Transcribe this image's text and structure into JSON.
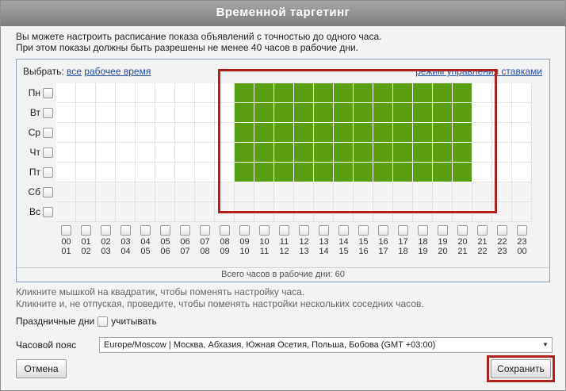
{
  "dialog": {
    "title": "Временной таргетинг",
    "info_line1": "Вы можете настроить расписание показа объявлений с точностью до одного часа.",
    "info_line2": "При этом показы должны быть разрешены не менее 40 часов в рабочие дни."
  },
  "panel": {
    "select_label": "Выбрать:",
    "select_all": "все",
    "select_work_time": "рабочее время",
    "mode_link": "режим управления ставками",
    "days": [
      "Пн",
      "Вт",
      "Ср",
      "Чт",
      "Пт",
      "Сб",
      "Вс"
    ],
    "hours_from": [
      "00",
      "01",
      "02",
      "03",
      "04",
      "05",
      "06",
      "07",
      "08",
      "09",
      "10",
      "11",
      "12",
      "13",
      "14",
      "15",
      "16",
      "17",
      "18",
      "19",
      "20",
      "21",
      "22",
      "23"
    ],
    "hours_to": [
      "01",
      "02",
      "03",
      "04",
      "05",
      "06",
      "07",
      "08",
      "09",
      "10",
      "11",
      "12",
      "13",
      "14",
      "15",
      "16",
      "17",
      "18",
      "19",
      "20",
      "21",
      "22",
      "23",
      "00"
    ],
    "schedule": {
      "weekdays_active_hours": "09–21",
      "weekdays_active_from_index": 9,
      "weekdays_active_to_index": 20,
      "weekend_active": false
    },
    "total_text": "Всего часов в рабочие дни: 60"
  },
  "hint": {
    "line1": "Кликните мышкой на квадратик, чтобы поменять настройку часа.",
    "line2": "Кликните и, не отпуская, проведите, чтобы поменять настройки нескольких соседних часов."
  },
  "holidays": {
    "label": "Праздничные дни",
    "checkbox_label": "учитывать"
  },
  "timezone": {
    "label": "Часовой пояс",
    "value": "Europe/Moscow | Москва, Абхазия, Южная Осетия, Польша, Бобова (GMT +03:00)"
  },
  "buttons": {
    "cancel": "Отмена",
    "save": "Сохранить"
  },
  "colors": {
    "active_cell": "#5a9e12",
    "highlight": "#b0201e",
    "link": "#1f4fa8"
  }
}
